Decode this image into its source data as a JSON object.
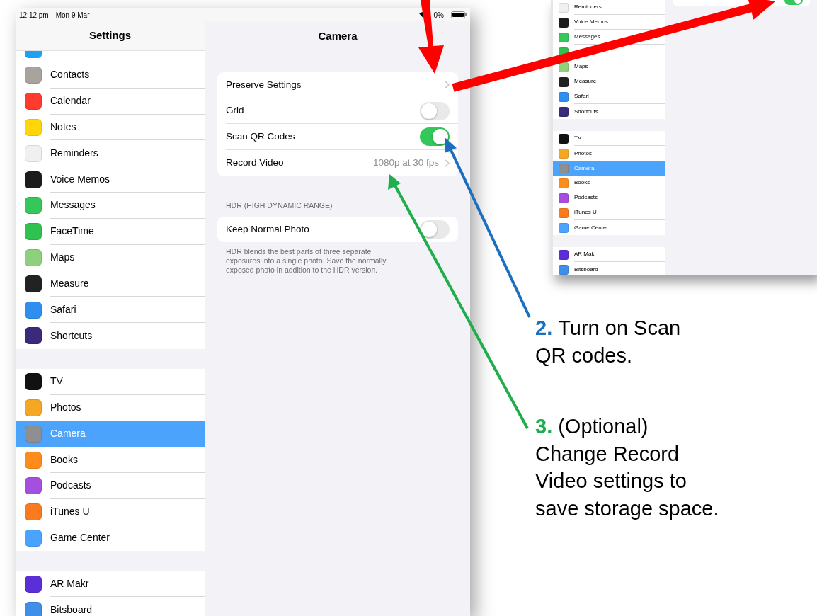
{
  "main_screenshot": {
    "status_bar": {
      "time": "12:12 pm",
      "date": "Mon 9 Mar",
      "battery": "0%"
    },
    "sidebar": {
      "title": "Settings",
      "groups": [
        [
          {
            "label": "Contacts",
            "color": "#a8a49c",
            "selected": false
          },
          {
            "label": "Calendar",
            "color": "#ff3b30",
            "selected": false
          },
          {
            "label": "Notes",
            "color": "#ffd60a",
            "selected": false
          },
          {
            "label": "Reminders",
            "color": "#f0f0f0",
            "selected": false
          },
          {
            "label": "Voice Memos",
            "color": "#1c1c1e",
            "selected": false
          },
          {
            "label": "Messages",
            "color": "#34c759",
            "selected": false
          },
          {
            "label": "FaceTime",
            "color": "#30c24f",
            "selected": false
          },
          {
            "label": "Maps",
            "color": "#8fd17a",
            "selected": false
          },
          {
            "label": "Measure",
            "color": "#222222",
            "selected": false
          },
          {
            "label": "Safari",
            "color": "#2f8ff0",
            "selected": false
          },
          {
            "label": "Shortcuts",
            "color": "#3b2a7a",
            "selected": false
          }
        ],
        [
          {
            "label": "TV",
            "color": "#111111",
            "selected": false
          },
          {
            "label": "Photos",
            "color": "#f5a623",
            "selected": false
          },
          {
            "label": "Camera",
            "color": "#8e8e93",
            "selected": true
          },
          {
            "label": "Books",
            "color": "#ff8c1a",
            "selected": false
          },
          {
            "label": "Podcasts",
            "color": "#a64ee0",
            "selected": false
          },
          {
            "label": "iTunes U",
            "color": "#fa7a1e",
            "selected": false
          },
          {
            "label": "Game Center",
            "color": "#4aa3ff",
            "selected": false
          }
        ],
        [
          {
            "label": "AR Makr",
            "color": "#5b2ed8",
            "selected": false
          },
          {
            "label": "Bitsboard",
            "color": "#3f8ee8",
            "selected": false
          }
        ]
      ]
    },
    "detail": {
      "title": "Camera",
      "groups": [
        {
          "rows": [
            {
              "kind": "link",
              "label": "Preserve Settings"
            },
            {
              "kind": "toggle",
              "label": "Grid",
              "on": false
            },
            {
              "kind": "toggle",
              "label": "Scan QR Codes",
              "on": true
            },
            {
              "kind": "link",
              "label": "Record Video",
              "value": "1080p at 30 fps"
            }
          ]
        },
        {
          "header": "HDR (HIGH DYNAMIC RANGE)",
          "rows": [
            {
              "kind": "toggle",
              "label": "Keep Normal Photo",
              "on": false
            }
          ],
          "footer": "HDR blends the best parts of three separate exposures into a single photo. Save the normally exposed photo in addition to the HDR version."
        }
      ]
    }
  },
  "inset_screenshot": {
    "sidebar": {
      "groups": [
        [
          {
            "label": "Reminders",
            "color": "#f0f0f0",
            "selected": false
          },
          {
            "label": "Voice Memos",
            "color": "#1c1c1e",
            "selected": false
          },
          {
            "label": "Messages",
            "color": "#34c759",
            "selected": false
          },
          {
            "color": "#30c24f",
            "selected": false
          },
          {
            "label": "Maps",
            "color": "#8fd17a",
            "selected": false
          },
          {
            "label": "Measure",
            "color": "#222222",
            "selected": false
          },
          {
            "label": "Safari",
            "color": "#2f8ff0",
            "selected": false
          },
          {
            "label": "Shortcuts",
            "color": "#3b2a7a",
            "selected": false
          }
        ],
        [
          {
            "label": "TV",
            "color": "#111111",
            "selected": false
          },
          {
            "label": "Photos",
            "color": "#f5a623",
            "selected": false
          },
          {
            "label": "Camera",
            "color": "#8e8e93",
            "selected": true
          },
          {
            "label": "Books",
            "color": "#ff8c1a",
            "selected": false
          },
          {
            "label": "Podcasts",
            "color": "#a64ee0",
            "selected": false
          },
          {
            "label": "iTunes U",
            "color": "#fa7a1e",
            "selected": false
          },
          {
            "label": "Game Center",
            "color": "#4aa3ff",
            "selected": false
          }
        ],
        [
          {
            "label": "AR Makr",
            "color": "#5b2ed8",
            "selected": false
          },
          {
            "label": "Bitsboard",
            "color": "#3f8ee8",
            "selected": false
          }
        ]
      ]
    },
    "detail": {
      "toggle_on": true
    }
  },
  "callouts": [
    {
      "number": "2.",
      "color": "#1a6fc0",
      "lines": [
        "Turn on Scan",
        "QR codes."
      ]
    },
    {
      "number": "3.",
      "color": "#1fae4b",
      "lines": [
        "(Optional)",
        "Change Record",
        "Video settings to",
        "save storage space."
      ]
    }
  ]
}
